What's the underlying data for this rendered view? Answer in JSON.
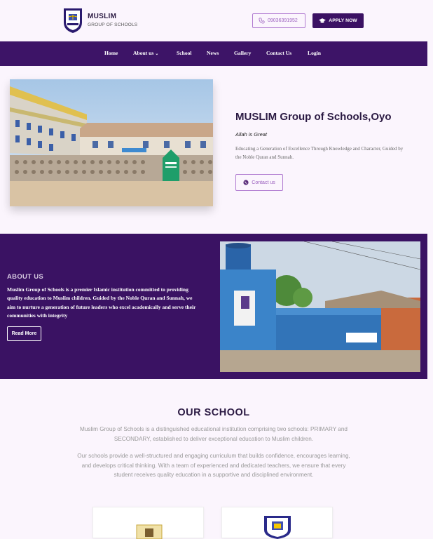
{
  "header": {
    "brand_title": "MUSLIM",
    "brand_subtitle": "GROUP OF SCHOOLS",
    "logo_icon": "crest-logo-icon",
    "phone": "09036391952",
    "phone_icon": "phone-icon",
    "apply_label": "APPLY NOW",
    "apply_icon": "graduation-cap-icon"
  },
  "nav": {
    "items": [
      {
        "label": "Home"
      },
      {
        "label": "About us",
        "has_dropdown": true
      },
      {
        "label": "School"
      },
      {
        "label": "News"
      },
      {
        "label": "Gallery"
      },
      {
        "label": "Contact Us"
      },
      {
        "label": "Login"
      }
    ],
    "dropdown_icon": "chevron-down-icon"
  },
  "hero": {
    "title": "MUSLIM Group of Schools,Oyo",
    "tagline": "Allah is Great",
    "description": "Educating a Generation of Excellence Through Knowledge and Character, Guided by the Noble Quran and Sunnah.",
    "contact_label": "Contact us",
    "contact_icon": "whatsapp-icon"
  },
  "about": {
    "heading": "ABOUT US",
    "text": "Muslim Group of Schools is a premier Islamic institution committed to providing quality education to Muslim children. Guided by the Noble Quran and Sunnah, we aim to nurture a generation of future leaders who excel academically and serve their communities with integrity",
    "read_more_label": "Read More"
  },
  "our_school": {
    "heading": "OUR SCHOOL",
    "paragraph1": "Muslim Group of Schools is a distinguished educational institution comprising two schools: PRIMARY and SECONDARY, established to deliver exceptional education to Muslim children.",
    "paragraph2": "Our schools provide a well-structured and engaging curriculum that builds confidence, encourages learning, and develops critical thinking. With a team of experienced and dedicated teachers, we ensure that every student receives quality education in a supportive and disciplined environment."
  },
  "colors": {
    "primary": "#3d1467",
    "accent": "#9a5fbe",
    "background": "#fbf5fd"
  }
}
